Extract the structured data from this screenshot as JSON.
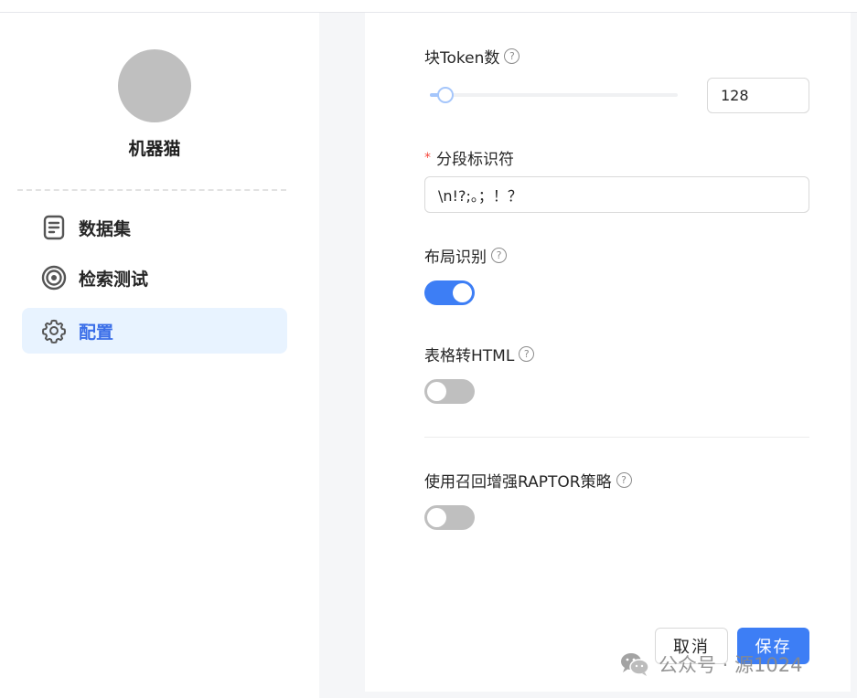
{
  "sidebar": {
    "username": "机器猫",
    "items": [
      {
        "label": "数据集",
        "icon": "document-icon",
        "active": false
      },
      {
        "label": "检索测试",
        "icon": "target-icon",
        "active": false
      },
      {
        "label": "配置",
        "icon": "gear-icon",
        "active": true
      }
    ]
  },
  "form": {
    "chunk_token": {
      "label": "块Token数",
      "value": "128",
      "slider_fraction": 0.06
    },
    "delimiter": {
      "label": "分段标识符",
      "required_mark": "*",
      "value": "\\n!?;。；！？"
    },
    "layout_recognize": {
      "label": "布局识别",
      "enabled": true
    },
    "table_to_html": {
      "label": "表格转HTML",
      "enabled": false
    },
    "raptor": {
      "label": "使用召回增强RAPTOR策略",
      "enabled": false
    },
    "help_glyph": "?"
  },
  "buttons": {
    "cancel": "取消",
    "save": "保存"
  },
  "watermark": {
    "text": "公众号 · 源1024"
  },
  "colors": {
    "accent": "#3d7ef5",
    "active_bg": "#e8f3ff",
    "switch_off": "#bfbfbf"
  }
}
